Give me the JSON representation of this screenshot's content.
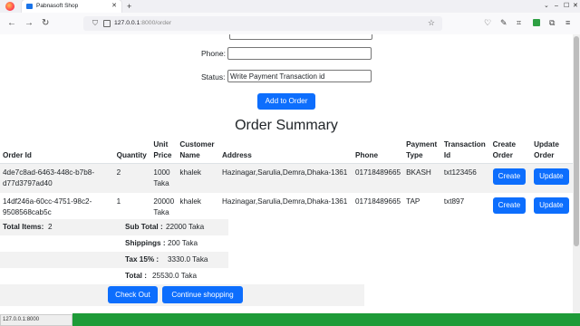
{
  "browser": {
    "tab_title": "Pabnasoft Shop",
    "new_tab": "+",
    "url_host": "127.0.0.1",
    "url_rest": ":8000/order",
    "status_url": "127.0.0.1:8000"
  },
  "form": {
    "phone_label": "Phone:",
    "phone_value": "",
    "status_label": "Status:",
    "status_value": "Write Payment  Transaction id",
    "add_button": "Add to Order"
  },
  "summary_title": "Order Summary",
  "table": {
    "headers": [
      "Order Id",
      "Quantity",
      "Unit Price",
      "Customer Name",
      "Address",
      "Phone",
      "Payment Type",
      "Transaction Id",
      "Create Order",
      "Update Order"
    ],
    "rows": [
      {
        "order_id": "4de7c8ad-6463-448c-b7b8-d77d3797ad40",
        "quantity": "2",
        "unit_price": "1000 Taka",
        "customer": "khalek",
        "address": "Hazinagar,Sarulia,Demra,Dhaka-1361",
        "phone": "01718489665",
        "payment": "BKASH",
        "transaction": "txt123456",
        "create": "Create",
        "update": "Update"
      },
      {
        "order_id": "14df246a-60cc-4751-98c2-9508568cab5c",
        "quantity": "1",
        "unit_price": "20000 Taka",
        "customer": "khalek",
        "address": "Hazinagar,Sarulia,Demra,Dhaka-1361",
        "phone": "01718489665",
        "payment": "TAP",
        "transaction": "txt897",
        "create": "Create",
        "update": "Update"
      }
    ]
  },
  "totals": {
    "items_label": "Total Items:",
    "items_value": "2",
    "subtotal_label": "Sub Total :",
    "subtotal_value": "22000 Taka",
    "shipping_label": "Shippings :",
    "shipping_value": "200 Taka",
    "tax_label": "Tax 15% :",
    "tax_value": "3330.0 Taka",
    "total_label": "Total :",
    "total_value": "25530.0 Taka"
  },
  "actions": {
    "checkout": "Check Out",
    "continue": "Continue shopping"
  },
  "colors": {
    "primary": "#0d6efd",
    "footer": "#1e9b38",
    "stripe": "#f2f2f2"
  }
}
